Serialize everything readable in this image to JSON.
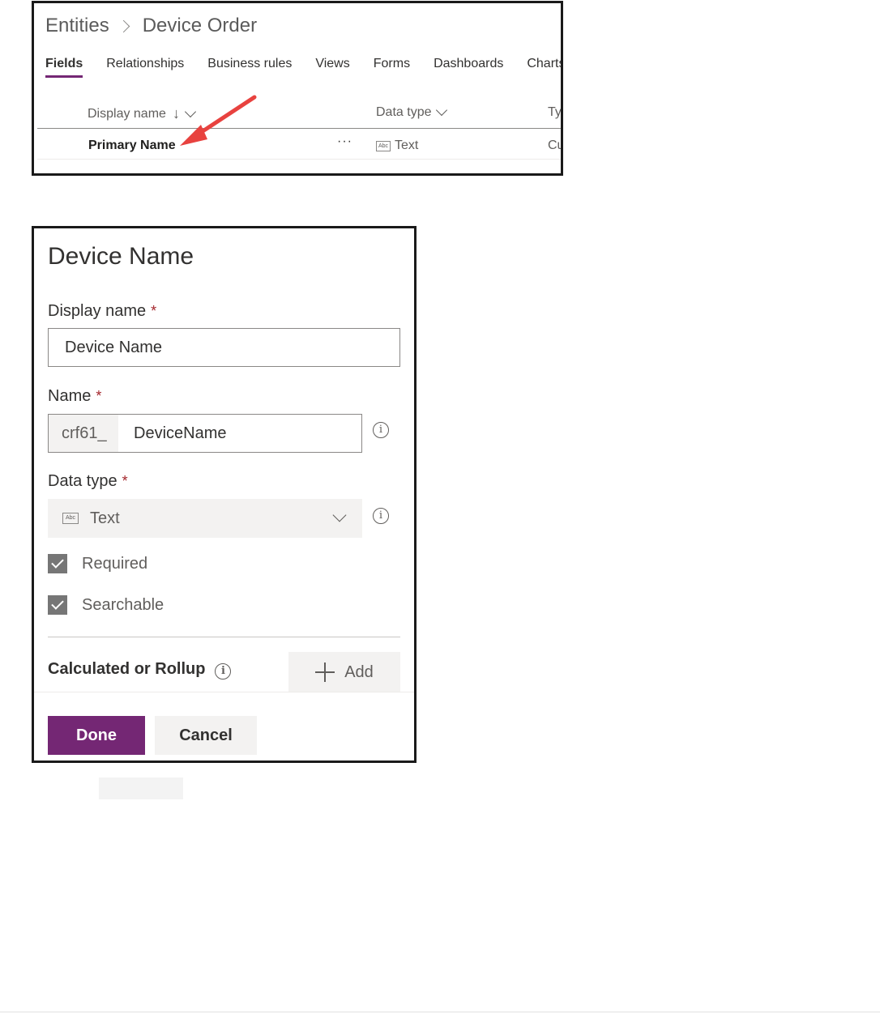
{
  "entities_view": {
    "breadcrumb": {
      "root": "Entities",
      "current": "Device Order"
    },
    "tabs": [
      {
        "label": "Fields",
        "active": true
      },
      {
        "label": "Relationships",
        "active": false
      },
      {
        "label": "Business rules",
        "active": false
      },
      {
        "label": "Views",
        "active": false
      },
      {
        "label": "Forms",
        "active": false
      },
      {
        "label": "Dashboards",
        "active": false
      },
      {
        "label": "Charts",
        "active": false
      }
    ],
    "columns": {
      "display_name": "Display name",
      "data_type": "Data type",
      "type_partial": "Ty"
    },
    "rows": [
      {
        "display_name": "Primary Name",
        "more": "···",
        "data_type": "Text",
        "type_partial": "Cu"
      }
    ],
    "data_type_icon_text": "Abc",
    "annotation_arrow_color": "#e8423f"
  },
  "field_form": {
    "title": "Device Name",
    "display_name": {
      "label": "Display name",
      "required_mark": "*",
      "value": "Device Name"
    },
    "name": {
      "label": "Name",
      "required_mark": "*",
      "prefix": "crf61_",
      "value": "DeviceName",
      "info_glyph": "i"
    },
    "data_type": {
      "label": "Data type",
      "required_mark": "*",
      "icon_text": "Abc",
      "value": "Text",
      "info_glyph": "i"
    },
    "checkboxes": [
      {
        "label": "Required",
        "checked": true
      },
      {
        "label": "Searchable",
        "checked": true
      }
    ],
    "calculated": {
      "label": "Calculated or Rollup",
      "info_glyph": "i",
      "add_label": "Add"
    },
    "buttons": {
      "done": "Done",
      "cancel": "Cancel"
    },
    "colors": {
      "primary": "#742774",
      "required": "#a4262c"
    }
  }
}
